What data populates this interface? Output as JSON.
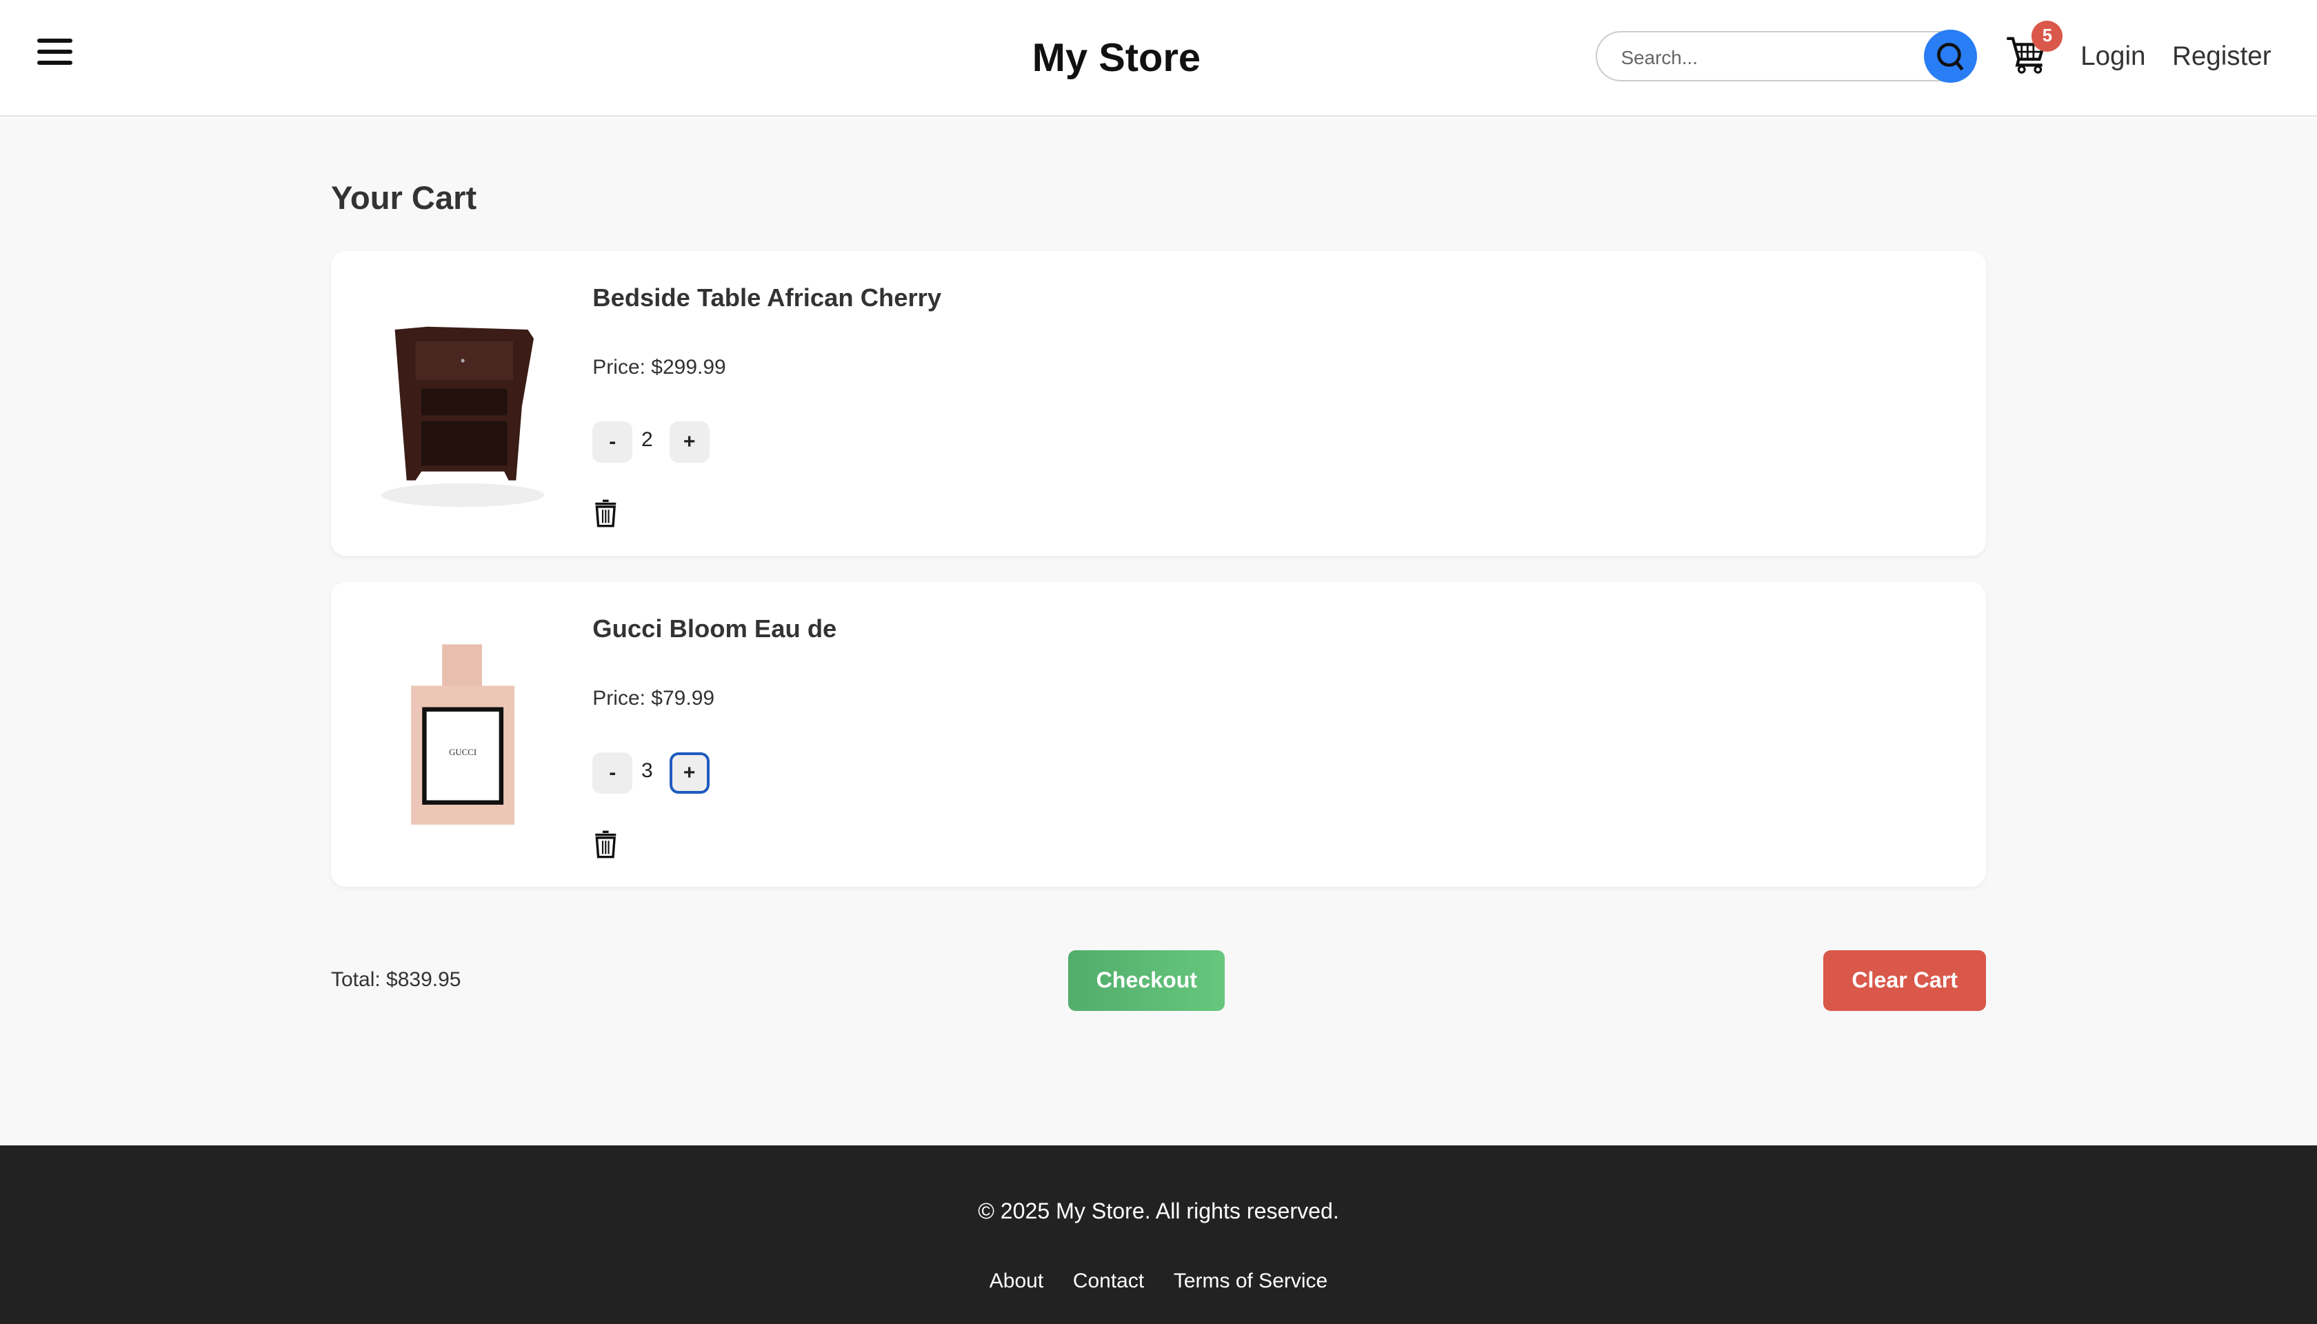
{
  "header": {
    "title": "My Store",
    "search_placeholder": "Search...",
    "cart_count": "5",
    "login": "Login",
    "register": "Register"
  },
  "page_title": "Your Cart",
  "items": [
    {
      "name": "Bedside Table African Cherry",
      "price": "Price: $299.99",
      "qty": "2",
      "minus": "-",
      "plus": "+"
    },
    {
      "name": "Gucci Bloom Eau de",
      "price": "Price: $79.99",
      "qty": "3",
      "minus": "-",
      "plus": "+"
    }
  ],
  "summary": {
    "total": "Total: $839.95",
    "checkout": "Checkout",
    "clear": "Clear Cart"
  },
  "footer": {
    "copyright": "© 2025 My Store. All rights reserved.",
    "links": [
      "About",
      "Contact",
      "Terms of Service"
    ]
  },
  "colors": {
    "accent": "#2a7ef5",
    "checkout": "#5cba74",
    "clear": "#d9584a",
    "footer": "#222222"
  }
}
